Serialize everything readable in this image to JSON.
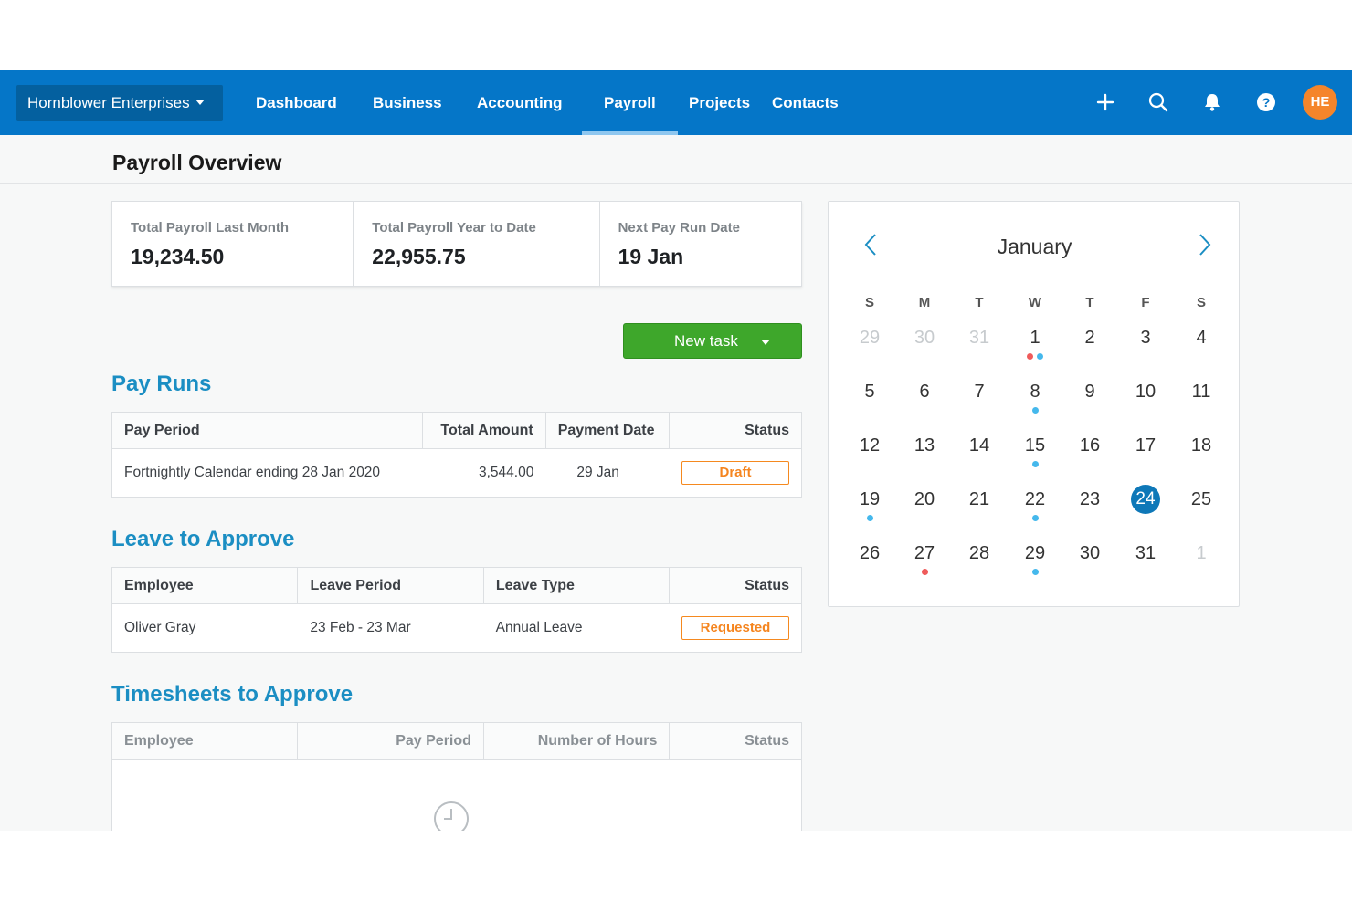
{
  "org": {
    "name": "Hornblower Enterprises"
  },
  "nav": {
    "items": [
      "Dashboard",
      "Business",
      "Accounting",
      "Payroll",
      "Projects",
      "Contacts"
    ],
    "active": "Payroll"
  },
  "user": {
    "initials": "HE"
  },
  "colors": {
    "nav_bg": "#0576c8",
    "accent": "#1b8ec3",
    "primary_button": "#3ea72b",
    "status_orange": "#f5851f",
    "avatar": "#f5852b",
    "today": "#0e78b8"
  },
  "page": {
    "title": "Payroll Overview"
  },
  "summary": [
    {
      "label": "Total Payroll Last Month",
      "value": "19,234.50"
    },
    {
      "label": "Total Payroll Year to Date",
      "value": "22,955.75"
    },
    {
      "label": "Next Pay Run Date",
      "value": "19 Jan"
    }
  ],
  "new_task": {
    "label": "New task"
  },
  "pay_runs": {
    "title": "Pay Runs",
    "headers": [
      "Pay Period",
      "Total Amount",
      "Payment Date",
      "Status"
    ],
    "rows": [
      {
        "period": "Fortnightly Calendar ending 28 Jan 2020",
        "amount": "3,544.00",
        "date": "29 Jan",
        "status": "Draft"
      }
    ]
  },
  "leave": {
    "title": "Leave to Approve",
    "headers": [
      "Employee",
      "Leave Period",
      "Leave Type",
      "Status"
    ],
    "rows": [
      {
        "employee": "Oliver Gray",
        "period": "23 Feb - 23 Mar",
        "type": "Annual Leave",
        "status": "Requested"
      }
    ]
  },
  "timesheets": {
    "title": "Timesheets to Approve",
    "headers": [
      "Employee",
      "Pay Period",
      "Number of Hours",
      "Status"
    ]
  },
  "calendar": {
    "month": "January",
    "weekdays": [
      "S",
      "M",
      "T",
      "W",
      "T",
      "F",
      "S"
    ],
    "weeks": [
      [
        29,
        30,
        31,
        1,
        2,
        3,
        4
      ],
      [
        5,
        6,
        7,
        8,
        9,
        10,
        11
      ],
      [
        12,
        13,
        14,
        15,
        16,
        17,
        18
      ],
      [
        19,
        20,
        21,
        22,
        23,
        24,
        25
      ],
      [
        26,
        27,
        28,
        29,
        30,
        31,
        1
      ]
    ],
    "other_month_days": [
      "29",
      "30",
      "31",
      "1-next"
    ],
    "today": 24,
    "event_markers": [
      {
        "day": 1,
        "markers": [
          "red",
          "blue"
        ]
      },
      {
        "day": 8,
        "markers": [
          "blue"
        ]
      },
      {
        "day": 15,
        "markers": [
          "blue"
        ]
      },
      {
        "day": 19,
        "markers": [
          "blue"
        ]
      },
      {
        "day": 22,
        "markers": [
          "blue"
        ]
      },
      {
        "day": 27,
        "markers": [
          "red"
        ]
      },
      {
        "day": 29,
        "markers": [
          "blue"
        ]
      }
    ]
  }
}
